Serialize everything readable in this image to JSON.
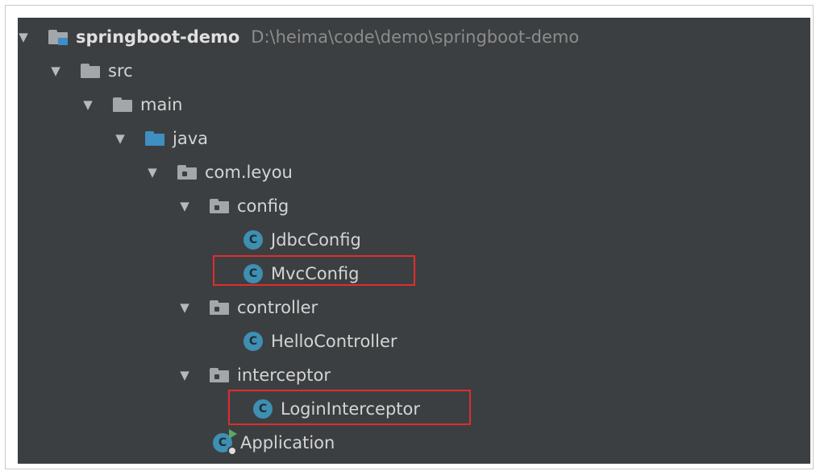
{
  "tree": {
    "project": {
      "name": "springboot-demo",
      "path": "D:\\heima\\code\\demo\\springboot-demo"
    },
    "src": "src",
    "main": "main",
    "java": "java",
    "package": "com.leyou",
    "config": {
      "label": "config",
      "classes": [
        "JdbcConfig",
        "MvcConfig"
      ]
    },
    "controller": {
      "label": "controller",
      "classes": [
        "HelloController"
      ]
    },
    "interceptor": {
      "label": "interceptor",
      "classes": [
        "LoginInterceptor"
      ]
    },
    "application": "Application"
  },
  "icons": {
    "expand": "expanded-arrow-icon",
    "folder": "folder-icon",
    "source_folder": "source-folder-icon",
    "package": "package-icon",
    "class": "class-icon",
    "app_class": "spring-boot-application-icon"
  },
  "colors": {
    "background": "#3c3f41",
    "text": "#d4d4d4",
    "class_icon": "#3e8fb2",
    "highlight_box": "#e12d2d"
  },
  "labels": {
    "class_letter": "C",
    "arrow_glyph": "▼"
  }
}
